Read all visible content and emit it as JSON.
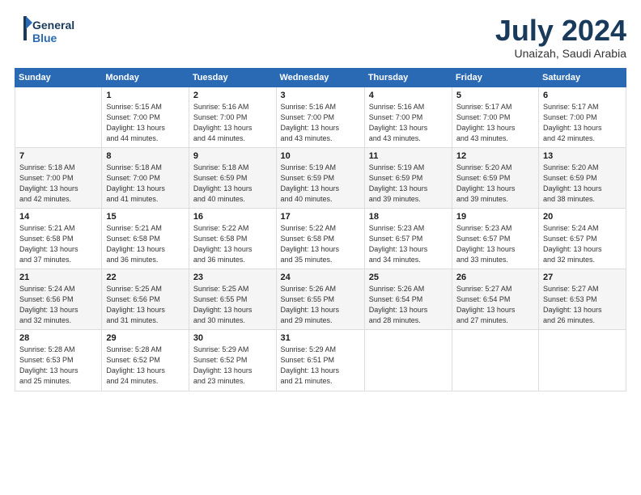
{
  "header": {
    "logo_line1": "General",
    "logo_line2": "Blue",
    "month_title": "July 2024",
    "location": "Unaizah, Saudi Arabia"
  },
  "weekdays": [
    "Sunday",
    "Monday",
    "Tuesday",
    "Wednesday",
    "Thursday",
    "Friday",
    "Saturday"
  ],
  "weeks": [
    [
      {
        "day": "",
        "info": ""
      },
      {
        "day": "1",
        "info": "Sunrise: 5:15 AM\nSunset: 7:00 PM\nDaylight: 13 hours\nand 44 minutes."
      },
      {
        "day": "2",
        "info": "Sunrise: 5:16 AM\nSunset: 7:00 PM\nDaylight: 13 hours\nand 44 minutes."
      },
      {
        "day": "3",
        "info": "Sunrise: 5:16 AM\nSunset: 7:00 PM\nDaylight: 13 hours\nand 43 minutes."
      },
      {
        "day": "4",
        "info": "Sunrise: 5:16 AM\nSunset: 7:00 PM\nDaylight: 13 hours\nand 43 minutes."
      },
      {
        "day": "5",
        "info": "Sunrise: 5:17 AM\nSunset: 7:00 PM\nDaylight: 13 hours\nand 43 minutes."
      },
      {
        "day": "6",
        "info": "Sunrise: 5:17 AM\nSunset: 7:00 PM\nDaylight: 13 hours\nand 42 minutes."
      }
    ],
    [
      {
        "day": "7",
        "info": "Sunrise: 5:18 AM\nSunset: 7:00 PM\nDaylight: 13 hours\nand 42 minutes."
      },
      {
        "day": "8",
        "info": "Sunrise: 5:18 AM\nSunset: 7:00 PM\nDaylight: 13 hours\nand 41 minutes."
      },
      {
        "day": "9",
        "info": "Sunrise: 5:18 AM\nSunset: 6:59 PM\nDaylight: 13 hours\nand 40 minutes."
      },
      {
        "day": "10",
        "info": "Sunrise: 5:19 AM\nSunset: 6:59 PM\nDaylight: 13 hours\nand 40 minutes."
      },
      {
        "day": "11",
        "info": "Sunrise: 5:19 AM\nSunset: 6:59 PM\nDaylight: 13 hours\nand 39 minutes."
      },
      {
        "day": "12",
        "info": "Sunrise: 5:20 AM\nSunset: 6:59 PM\nDaylight: 13 hours\nand 39 minutes."
      },
      {
        "day": "13",
        "info": "Sunrise: 5:20 AM\nSunset: 6:59 PM\nDaylight: 13 hours\nand 38 minutes."
      }
    ],
    [
      {
        "day": "14",
        "info": "Sunrise: 5:21 AM\nSunset: 6:58 PM\nDaylight: 13 hours\nand 37 minutes."
      },
      {
        "day": "15",
        "info": "Sunrise: 5:21 AM\nSunset: 6:58 PM\nDaylight: 13 hours\nand 36 minutes."
      },
      {
        "day": "16",
        "info": "Sunrise: 5:22 AM\nSunset: 6:58 PM\nDaylight: 13 hours\nand 36 minutes."
      },
      {
        "day": "17",
        "info": "Sunrise: 5:22 AM\nSunset: 6:58 PM\nDaylight: 13 hours\nand 35 minutes."
      },
      {
        "day": "18",
        "info": "Sunrise: 5:23 AM\nSunset: 6:57 PM\nDaylight: 13 hours\nand 34 minutes."
      },
      {
        "day": "19",
        "info": "Sunrise: 5:23 AM\nSunset: 6:57 PM\nDaylight: 13 hours\nand 33 minutes."
      },
      {
        "day": "20",
        "info": "Sunrise: 5:24 AM\nSunset: 6:57 PM\nDaylight: 13 hours\nand 32 minutes."
      }
    ],
    [
      {
        "day": "21",
        "info": "Sunrise: 5:24 AM\nSunset: 6:56 PM\nDaylight: 13 hours\nand 32 minutes."
      },
      {
        "day": "22",
        "info": "Sunrise: 5:25 AM\nSunset: 6:56 PM\nDaylight: 13 hours\nand 31 minutes."
      },
      {
        "day": "23",
        "info": "Sunrise: 5:25 AM\nSunset: 6:55 PM\nDaylight: 13 hours\nand 30 minutes."
      },
      {
        "day": "24",
        "info": "Sunrise: 5:26 AM\nSunset: 6:55 PM\nDaylight: 13 hours\nand 29 minutes."
      },
      {
        "day": "25",
        "info": "Sunrise: 5:26 AM\nSunset: 6:54 PM\nDaylight: 13 hours\nand 28 minutes."
      },
      {
        "day": "26",
        "info": "Sunrise: 5:27 AM\nSunset: 6:54 PM\nDaylight: 13 hours\nand 27 minutes."
      },
      {
        "day": "27",
        "info": "Sunrise: 5:27 AM\nSunset: 6:53 PM\nDaylight: 13 hours\nand 26 minutes."
      }
    ],
    [
      {
        "day": "28",
        "info": "Sunrise: 5:28 AM\nSunset: 6:53 PM\nDaylight: 13 hours\nand 25 minutes."
      },
      {
        "day": "29",
        "info": "Sunrise: 5:28 AM\nSunset: 6:52 PM\nDaylight: 13 hours\nand 24 minutes."
      },
      {
        "day": "30",
        "info": "Sunrise: 5:29 AM\nSunset: 6:52 PM\nDaylight: 13 hours\nand 23 minutes."
      },
      {
        "day": "31",
        "info": "Sunrise: 5:29 AM\nSunset: 6:51 PM\nDaylight: 13 hours\nand 21 minutes."
      },
      {
        "day": "",
        "info": ""
      },
      {
        "day": "",
        "info": ""
      },
      {
        "day": "",
        "info": ""
      }
    ]
  ]
}
